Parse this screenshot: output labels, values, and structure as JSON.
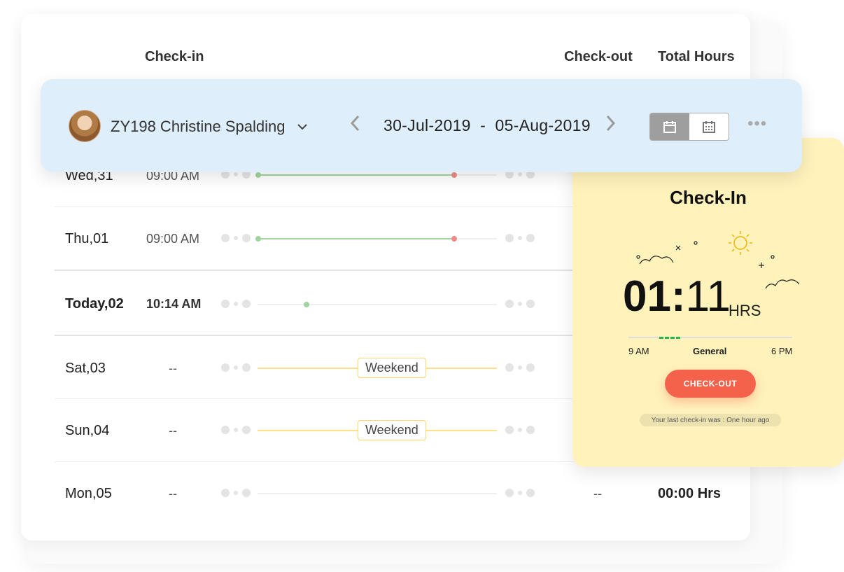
{
  "columns": {
    "checkin": "Check-in",
    "checkout": "Check-out",
    "total_hours": "Total Hours"
  },
  "toolbar": {
    "employee_name": "ZY198 Christine Spalding",
    "date_range": "30-Jul-2019  -  05-Aug-2019",
    "more_label": "•••"
  },
  "rows": [
    {
      "day": "Wed,31",
      "checkin": "09:00 AM"
    },
    {
      "day": "Thu,01",
      "checkin": "09:00 AM"
    },
    {
      "day": "Today,02",
      "checkin": "10:14 AM"
    },
    {
      "day": "Sat,03",
      "checkin": "--",
      "tag": "Weekend"
    },
    {
      "day": "Sun,04",
      "checkin": "--",
      "tag": "Weekend"
    },
    {
      "day": "Mon,05",
      "checkin": "--",
      "checkout": "--",
      "total": "00:00 Hrs"
    }
  ],
  "panel": {
    "title": "Check-In",
    "hours": "01:",
    "minutes": "11",
    "unit": "HRS",
    "shift_start": "9 AM",
    "shift_name": "General",
    "shift_end": "6 PM",
    "button_label": "CHECK-OUT",
    "last_checkin": "Your last check-in was : One hour ago"
  },
  "colors": {
    "accent": "#f4624b",
    "toolbar_bg": "#dfeefb",
    "panel_bg": "#fff2bb",
    "present": "#9fd49f",
    "late": "#f08a8a",
    "weekend": "#ffe08a"
  }
}
